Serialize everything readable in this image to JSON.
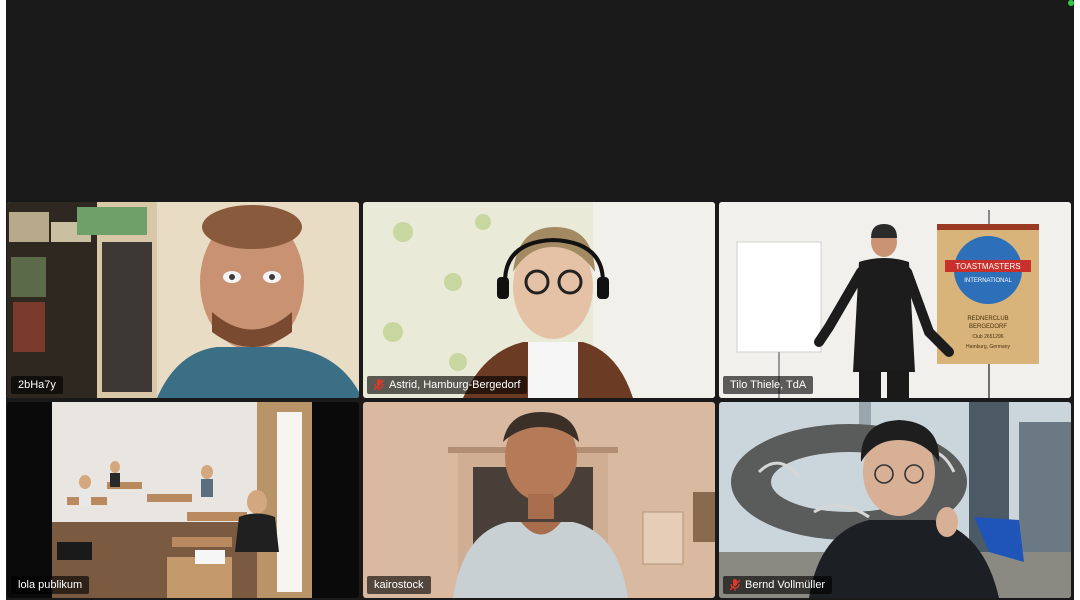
{
  "meeting": {
    "participants": [
      {
        "name": "2bHa7y",
        "muted": false,
        "active": false
      },
      {
        "name": "Astrid, Hamburg-Bergedorf",
        "muted": true,
        "active": false
      },
      {
        "name": "Tilo Thiele, TdA",
        "muted": false,
        "active": true
      },
      {
        "name": "lola publikum",
        "muted": false,
        "active": false
      },
      {
        "name": "kairostock",
        "muted": false,
        "active": false
      },
      {
        "name": "Bernd Vollmüller",
        "muted": true,
        "active": false
      }
    ],
    "banner": {
      "line1": "TOASTMASTERS",
      "line2": "INTERNATIONAL",
      "club_line1": "REDNERCLUB",
      "club_line2": "BERGEDORF",
      "club_number": "Club 2651296",
      "city": "Hamburg, Germany"
    },
    "colors": {
      "active_border": "#3ed13e",
      "muted_icon": "#e0362c",
      "background": "#1a1a1a"
    }
  }
}
